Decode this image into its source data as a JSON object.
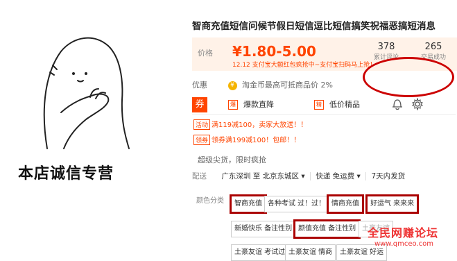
{
  "left": {
    "slogan": "本店诚信专营"
  },
  "product": {
    "title": "智商充值短信问候节假日短信逗比短信搞笑祝福恶搞短消息"
  },
  "price": {
    "label": "价格",
    "value": "¥1.80-5.00",
    "promo": "12.12 支付宝大额红包疯抢中~支付宝扫码马上抢！",
    "reviews_count": "378",
    "reviews_label": "累计评论",
    "sales_count": "265",
    "sales_label": "交易成功"
  },
  "discount": {
    "label": "优惠",
    "text": "淘金币最高可抵商品价 2%"
  },
  "tabs": {
    "coupon_tag": "券",
    "tab1": "爆款直降",
    "tab1_icon": "爆",
    "tab2": "低价精品",
    "tab2_icon": "精"
  },
  "coupons": [
    {
      "tag": "活动",
      "text": "满119减100，卖家大放送！！"
    },
    {
      "tag": "领券",
      "text": "领券满199减100！包邮！！"
    }
  ],
  "fast": "超级尖货，限时疯抢",
  "shipping": {
    "label": "配送",
    "from": "广东深圳",
    "to_prefix": "至",
    "to": "北京东城区",
    "method": "快递 免运费",
    "days": "7天内发货"
  },
  "colors": {
    "label": "颜色分类",
    "options": [
      "智商充值",
      "各种考试 过！过！",
      "情商充值",
      "好运气 来来来",
      "新婚快乐 备注性别",
      "颜值充值 备注性别",
      "土豪友谊",
      "土豪友谊 考试过",
      "土豪友谊 情商",
      "土豪友谊 好运"
    ]
  },
  "watermark": {
    "name": "全民网赚论坛",
    "url": "www.qmceo.com"
  }
}
